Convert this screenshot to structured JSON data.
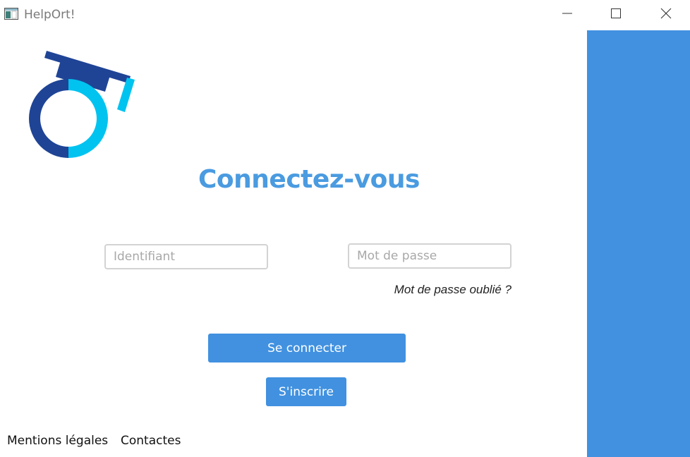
{
  "window": {
    "title": "HelpOrt!",
    "icon": "app-window-icon",
    "controls": {
      "minimize_icon": "minimize-icon",
      "maximize_icon": "maximize-icon",
      "close_icon": "close-icon"
    }
  },
  "logo": {
    "name": "helport-logo",
    "colors": {
      "dark": "#1f4496",
      "light": "#00c3f0"
    }
  },
  "login": {
    "heading": "Connectez-vous",
    "username_placeholder": "Identifiant",
    "username_value": "",
    "password_placeholder": "Mot de passe",
    "password_value": "",
    "forgot_password": "Mot de passe oublié ?",
    "login_button": "Se connecter",
    "signup_button": "S'inscrire"
  },
  "footer": {
    "legal": "Mentions légales",
    "contact": "Contactes"
  },
  "colors": {
    "accent": "#4191e0",
    "heading": "#4a9be0",
    "side_panel": "#4191e0"
  }
}
